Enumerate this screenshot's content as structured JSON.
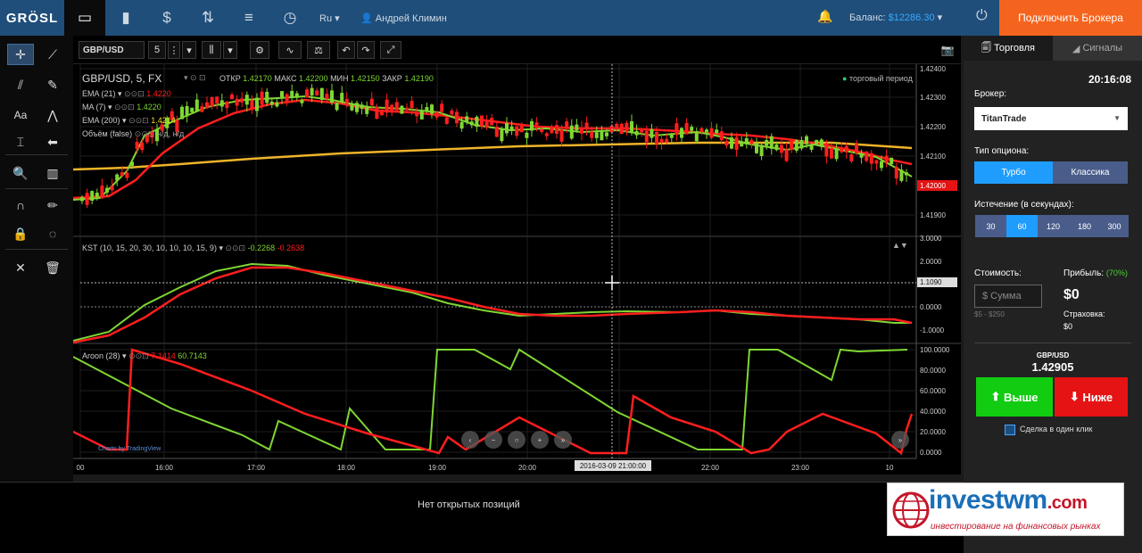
{
  "topnav": {
    "logo": "GRÖSL",
    "lang": "Ru",
    "user": "Андрей Климин",
    "balance_label": "Баланс:",
    "balance_value": "$12286.30",
    "connect_broker": "Подключить Брокера"
  },
  "chart_toolbar": {
    "symbol": "GBP/USD",
    "interval": "5"
  },
  "main_legend": {
    "title": "GBP/USD, 5, FX",
    "open_label": "ОТКР",
    "open": "1.42170",
    "high_label": "МАКС",
    "high": "1.42200",
    "low_label": "МИН",
    "low": "1.42150",
    "close_label": "ЗАКР",
    "close": "1.42190",
    "trading_period": "торговый период",
    "ema21": "EMA (21)",
    "ema21_val": "1.4220",
    "ma7": "MA (7)",
    "ma7_val": "1.4220",
    "ema200": "EMA (200)",
    "ema200_val": "1.4214",
    "volume": "Объём (false)",
    "volume_val": "н/д, н/д"
  },
  "kst_legend": {
    "title": "KST (10, 15, 20, 30, 10, 10, 10, 15, 9)",
    "v1": "-0.2268",
    "v2": "-0.2638"
  },
  "aroon_legend": {
    "title": "Aroon (28)",
    "v1": "7.1414",
    "v2": "60.7143"
  },
  "main_price_scale": [
    "1.42400",
    "1.42300",
    "1.42200",
    "1.42100",
    "1.41900"
  ],
  "main_price_marker": "1.42000",
  "kst_scale": [
    "3.0000",
    "2.0000",
    "1.0000",
    "0.0000",
    "-1.0000"
  ],
  "kst_marker": "1.1090",
  "aroon_scale": [
    "100.0000",
    "80.0000",
    "60.0000",
    "40.0000",
    "20.0000",
    "0.0000"
  ],
  "time_axis": [
    "00",
    "16:00",
    "17:00",
    "18:00",
    "19:00",
    "20:00",
    "22:00",
    "23:00",
    "10"
  ],
  "crosshair_time": "2016-03-09 21:00:00",
  "tradingview_credit": "Charts by TradingView",
  "colors": {
    "green": "#7fd632",
    "red": "#ff1e1e",
    "ema200": "#f0b429",
    "accent": "#1e90ff",
    "brand": "#f5641e"
  },
  "right_panel": {
    "tab_trade": "Торговля",
    "tab_signals": "Сигналы",
    "time": "20:16:08",
    "broker_label": "Брокер:",
    "broker_value": "TitanTrade",
    "option_type_label": "Тип опциона:",
    "option_turbo": "Турбо",
    "option_classic": "Классика",
    "expiry_label": "Истечение (в секундах):",
    "expiry_options": [
      "30",
      "60",
      "120",
      "180",
      "300"
    ],
    "cost_label": "Стоимость:",
    "sum_placeholder": "$ Сумма",
    "range": "$5 - $250",
    "profit_label": "Прибыль:",
    "profit_pct": "(70%)",
    "profit_value": "$0",
    "insurance_label": "Страховка:",
    "insurance_value": "$0",
    "pair": "GBP/USD",
    "price": "1.42905",
    "up_label": "Выше",
    "down_label": "Ниже",
    "oneclick_label": "Сделка в один клик"
  },
  "bottom": {
    "no_positions": "Нет открытых позиций"
  },
  "watermark": {
    "text_main": "investwm",
    "text_dom": ".com",
    "sub": "инвестирование на финансовых рынках"
  }
}
